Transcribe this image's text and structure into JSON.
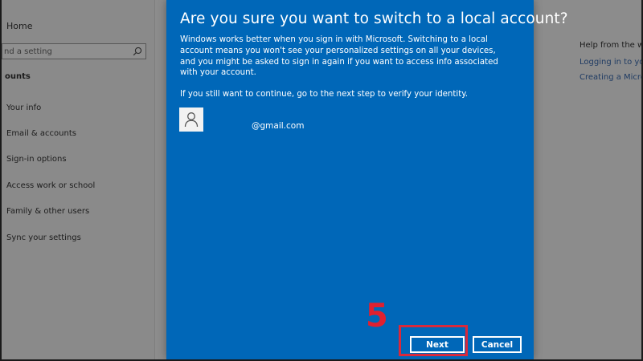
{
  "settings": {
    "home_label": "Home",
    "search_placeholder": "nd a setting",
    "section_heading": "ounts",
    "nav_items": [
      {
        "label": "Your info"
      },
      {
        "label": "Email & accounts"
      },
      {
        "label": "Sign-in options"
      },
      {
        "label": "Access work or school"
      },
      {
        "label": "Family & other users"
      },
      {
        "label": "Sync your settings"
      }
    ],
    "help_title": "Help from the web",
    "help_links": [
      {
        "label": "Logging in to your"
      },
      {
        "label": "Creating a Microso"
      }
    ]
  },
  "dialog": {
    "title": "Are you sure you want to switch to a local account?",
    "body_1": "Windows works better when you sign in with Microsoft. Switching to a local account means you won't see your personalized settings on all your devices, and you might be asked to sign in again if you want to access info associated with your account.",
    "body_2": "If you still want to continue, go to the next step to verify your identity.",
    "account_email": "@gmail.com",
    "next_label": "Next",
    "cancel_label": "Cancel",
    "accent_color": "#0067b8"
  },
  "annotation": {
    "step_number": "5",
    "color": "#e02030"
  }
}
